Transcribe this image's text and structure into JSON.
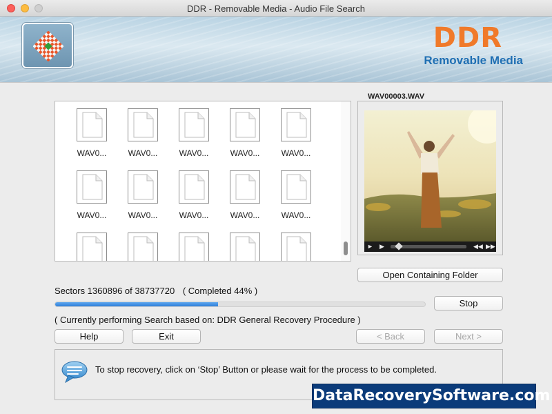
{
  "window": {
    "title": "DDR - Removable Media - Audio File Search"
  },
  "brand": {
    "name": "DDR",
    "product": "Removable Media",
    "accent": "#f07a2a",
    "product_color": "#1f6fb3"
  },
  "thumbnails": [
    "WAV0...",
    "WAV0...",
    "WAV0...",
    "WAV0...",
    "WAV0...",
    "WAV0...",
    "WAV0...",
    "WAV0...",
    "WAV0...",
    "WAV0...",
    "",
    "",
    "",
    "",
    ""
  ],
  "preview": {
    "file_name": "WAV00003.WAV",
    "open_folder_label": "Open Containing Folder"
  },
  "progress": {
    "sectors_text": "Sectors 1360896 of 38737720",
    "completed_text": "( Completed  44% )",
    "percent": 44,
    "stop_label": "Stop",
    "procedure_text": "( Currently performing Search based on: DDR General Recovery Procedure )"
  },
  "nav": {
    "help_label": "Help",
    "exit_label": "Exit",
    "back_label": "< Back",
    "next_label": "Next >"
  },
  "info": {
    "message": "To stop recovery, click on ‘Stop’ Button or please wait for the process to be completed."
  },
  "watermark": "DataRecoverySoftware.com"
}
